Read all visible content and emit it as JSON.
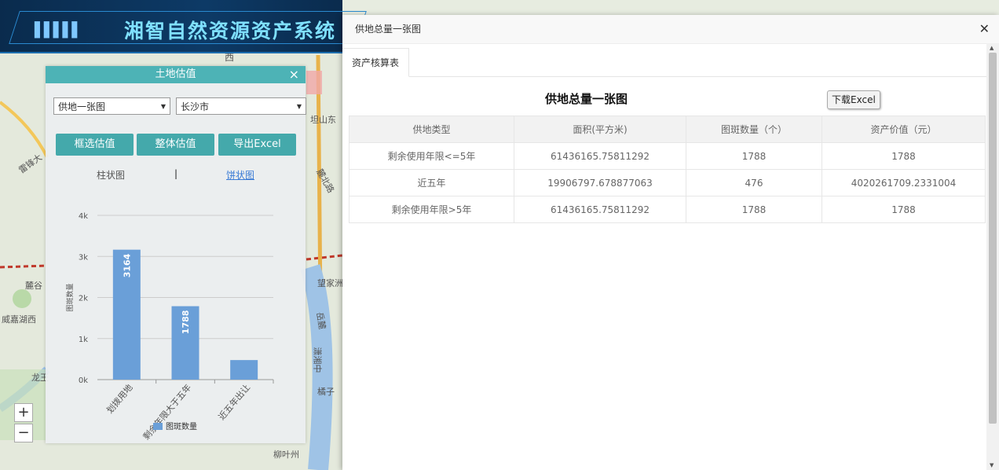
{
  "app": {
    "title": "湘智自然资源资产系统"
  },
  "panel": {
    "title": "土地估值",
    "select1": "供地一张图",
    "select2": "长沙市",
    "btn_box": "框选估值",
    "btn_whole": "整体估值",
    "btn_export": "导出Excel",
    "tab_bar": "柱状图",
    "tab_sep": "|",
    "tab_pie": "饼状图"
  },
  "chart_data": {
    "type": "bar",
    "categories": [
      "划拨用地",
      "剩余年限大于五年",
      "近五年出让"
    ],
    "series": [
      {
        "name": "图斑数量",
        "values": [
          3164,
          1788,
          476
        ]
      }
    ],
    "value_labels": [
      "3164",
      "1788",
      ""
    ],
    "ylabel": "图斑数量",
    "yticks": [
      "0k",
      "1k",
      "2k",
      "3k",
      "4k"
    ],
    "ylim": [
      0,
      4000
    ],
    "legend": "bottom",
    "color": "#6a9fd8"
  },
  "map_labels": [
    "西",
    "坦山东",
    "雷锋大",
    "麓谷",
    "威嘉湖西",
    "麓北路",
    "望家洲",
    "岳麓",
    "潇湘中",
    "橘子",
    "龙王",
    "柳叶州"
  ],
  "zoom": {
    "in": "+",
    "out": "−"
  },
  "modal": {
    "title": "供地总量一张图",
    "tab": "资产核算表",
    "report_title": "供地总量一张图",
    "download": "下载Excel",
    "headers": [
      "供地类型",
      "面积(平方米)",
      "图斑数量（个）",
      "资产价值（元）"
    ],
    "rows": [
      [
        "剩余使用年限<=5年",
        "61436165.75811292",
        "1788",
        "1788"
      ],
      [
        "近五年",
        "19906797.678877063",
        "476",
        "4020261709.2331004"
      ],
      [
        "剩余使用年限>5年",
        "61436165.75811292",
        "1788",
        "1788"
      ]
    ]
  },
  "colors": {
    "accent": "#44a9ab",
    "panel_header": "#4db3b6",
    "banner": "#0d3a66"
  }
}
